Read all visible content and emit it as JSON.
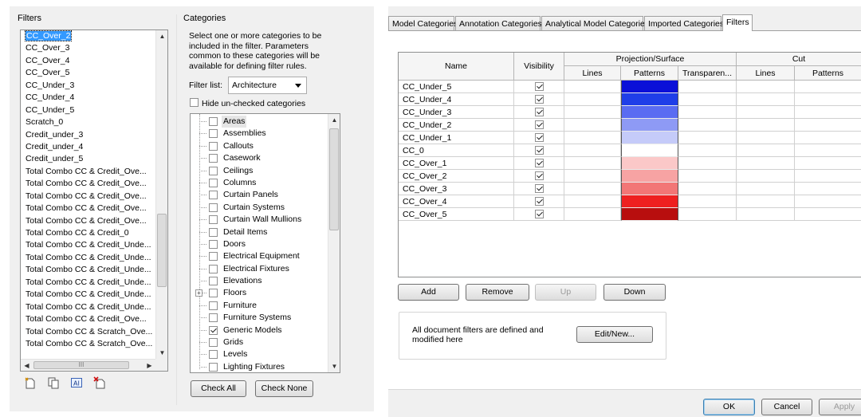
{
  "left": {
    "filters_title": "Filters",
    "filters": [
      "CC_Over_2",
      "CC_Over_3",
      "CC_Over_4",
      "CC_Over_5",
      "CC_Under_3",
      "CC_Under_4",
      "CC_Under_5",
      "Scratch_0",
      "Credit_under_3",
      "Credit_under_4",
      "Credit_under_5",
      "Total Combo CC & Credit_Ove...",
      "Total Combo CC & Credit_Ove...",
      "Total Combo CC & Credit_Ove...",
      "Total Combo CC & Credit_Ove...",
      "Total Combo CC & Credit_Ove...",
      "Total Combo CC & Credit_0",
      "Total Combo CC & Credit_Unde...",
      "Total Combo CC & Credit_Unde...",
      "Total Combo CC & Credit_Unde...",
      "Total Combo CC & Credit_Unde...",
      "Total Combo CC & Credit_Unde...",
      "Total Combo CC & Credit_Unde...",
      "Total Combo CC & Credit_Ove...",
      "Total Combo CC & Scratch_Ove...",
      "Total Combo CC & Scratch_Ove..."
    ],
    "selected_filter_index": 0,
    "hscroll_thumb_glyph": "III",
    "categories_title": "Categories",
    "categories_description": "Select one or more categories to be included in the filter. Parameters common to these categories will be available for defining filter rules.",
    "filter_list_label": "Filter list:",
    "filter_list_value": "Architecture",
    "hide_unchecked_label": "Hide un-checked categories",
    "categories": [
      {
        "label": "Areas",
        "checked": false,
        "selected": true
      },
      {
        "label": "Assemblies",
        "checked": false
      },
      {
        "label": "Callouts",
        "checked": false
      },
      {
        "label": "Casework",
        "checked": false
      },
      {
        "label": "Ceilings",
        "checked": false
      },
      {
        "label": "Columns",
        "checked": false
      },
      {
        "label": "Curtain Panels",
        "checked": false
      },
      {
        "label": "Curtain Systems",
        "checked": false
      },
      {
        "label": "Curtain Wall Mullions",
        "checked": false
      },
      {
        "label": "Detail Items",
        "checked": false
      },
      {
        "label": "Doors",
        "checked": false
      },
      {
        "label": "Electrical Equipment",
        "checked": false
      },
      {
        "label": "Electrical Fixtures",
        "checked": false
      },
      {
        "label": "Elevations",
        "checked": false
      },
      {
        "label": "Floors",
        "checked": false,
        "expander": "+"
      },
      {
        "label": "Furniture",
        "checked": false
      },
      {
        "label": "Furniture Systems",
        "checked": false
      },
      {
        "label": "Generic Models",
        "checked": true
      },
      {
        "label": "Grids",
        "checked": false
      },
      {
        "label": "Levels",
        "checked": false
      },
      {
        "label": "Lighting Fixtures",
        "checked": false
      }
    ],
    "check_all_label": "Check All",
    "check_none_label": "Check None"
  },
  "right": {
    "tabs": [
      {
        "label": "Model Categories",
        "active": false
      },
      {
        "label": "Annotation Categories",
        "active": false
      },
      {
        "label": "Analytical Model Categories",
        "active": false
      },
      {
        "label": "Imported Categories",
        "active": false
      },
      {
        "label": "Filters",
        "active": true
      }
    ],
    "headers": {
      "name": "Name",
      "visibility": "Visibility",
      "projection_surface": "Projection/Surface",
      "lines": "Lines",
      "patterns": "Patterns",
      "transparency": "Transparen...",
      "cut": "Cut",
      "cut_lines": "Lines",
      "cut_patterns": "Patterns"
    },
    "rows": [
      {
        "name": "CC_Under_5",
        "visible": true,
        "color": "#0b10d8"
      },
      {
        "name": "CC_Under_4",
        "visible": true,
        "color": "#1f3ee8"
      },
      {
        "name": "CC_Under_3",
        "visible": true,
        "color": "#5a6cf2"
      },
      {
        "name": "CC_Under_2",
        "visible": true,
        "color": "#8e9af5"
      },
      {
        "name": "CC_Under_1",
        "visible": true,
        "color": "#c5cbf9"
      },
      {
        "name": "CC_0",
        "visible": true,
        "color": "#ffffff"
      },
      {
        "name": "CC_Over_1",
        "visible": true,
        "color": "#fbc8c8"
      },
      {
        "name": "CC_Over_2",
        "visible": true,
        "color": "#f7a3a3"
      },
      {
        "name": "CC_Over_3",
        "visible": true,
        "color": "#f27676"
      },
      {
        "name": "CC_Over_4",
        "visible": true,
        "color": "#ee2020"
      },
      {
        "name": "CC_Over_5",
        "visible": true,
        "color": "#b80e0e"
      }
    ],
    "buttons": {
      "add": "Add",
      "remove": "Remove",
      "up": "Up",
      "down": "Down",
      "edit_new": "Edit/New...",
      "ok": "OK",
      "cancel": "Cancel",
      "apply": "Apply"
    },
    "panel_text": "All document filters are defined and modified here"
  }
}
